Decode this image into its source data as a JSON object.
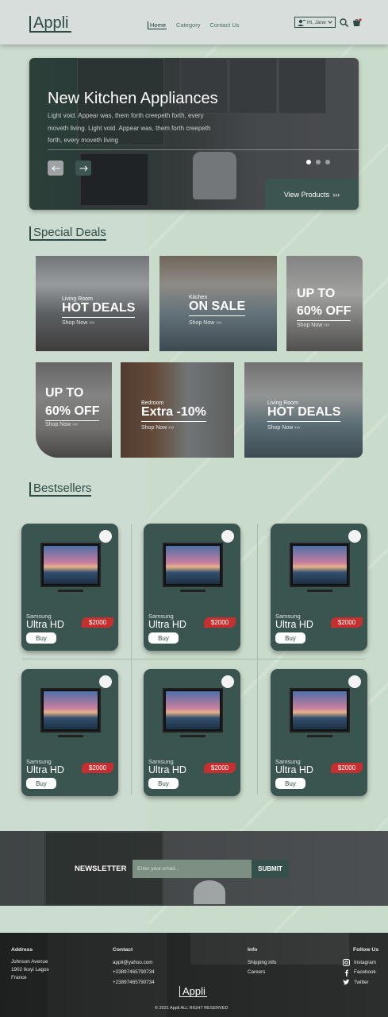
{
  "header": {
    "logo": "Appli",
    "nav": [
      "Home",
      "Category",
      "Contact Us"
    ],
    "user_label": "Hi, Jane"
  },
  "hero": {
    "title": "New Kitchen Appliances",
    "description": "Light void. Appear was, them forth creepeth forth, every moveth living. Light void. Appear was, them forth creepeth forth, every moveth living",
    "prev_icon": "arrow-left-icon",
    "next_icon": "arrow-right-icon",
    "slides": 3,
    "active_slide": 1,
    "cta": "View Products",
    "cta_arrows": "›››"
  },
  "special_deals": {
    "title": "Special Deals",
    "deals": [
      {
        "category": "Living Room",
        "headline": "HOT DEALS",
        "link": "Shop Now"
      },
      {
        "category": "Kitchen",
        "headline": "ON  SALE",
        "link": "Shop Now"
      },
      {
        "category": "",
        "headline": "UP TO",
        "headline2": "60% OFF",
        "link": "Shop Now"
      },
      {
        "category": "",
        "headline": "UP TO",
        "headline2": "60% OFF",
        "link": "Shop Now"
      },
      {
        "category": "Bedroom",
        "headline": "Extra -10%",
        "link": "Shop Now"
      },
      {
        "category": "Living Room",
        "headline": "HOT DEALS",
        "link": "Shop Now"
      }
    ],
    "arrows": "›››"
  },
  "bestsellers": {
    "title": "Bestsellers",
    "products": [
      {
        "brand": "Samsung",
        "model": "Ultra HD",
        "price": "$2000",
        "buy": "Buy"
      },
      {
        "brand": "Samsung",
        "model": "Ultra HD",
        "price": "$2000",
        "buy": "Buy"
      },
      {
        "brand": "Samsung",
        "model": "Ultra HD",
        "price": "$2000",
        "buy": "Buy"
      },
      {
        "brand": "Samsung",
        "model": "Ultra HD",
        "price": "$2000",
        "buy": "Buy"
      },
      {
        "brand": "Samsung",
        "model": "Ultra HD",
        "price": "$2000",
        "buy": "Buy"
      },
      {
        "brand": "Samsung",
        "model": "Ultra HD",
        "price": "$2000",
        "buy": "Buy"
      }
    ]
  },
  "newsletter": {
    "label": "NEWSLETTER",
    "placeholder": "Enter your email...",
    "submit": "SUBMIT"
  },
  "footer": {
    "address": {
      "heading": "Address",
      "lines": [
        "Johnson Avenue",
        "1902 Ikoyi Lagos",
        "France"
      ]
    },
    "contact": {
      "heading": "Contact",
      "lines": [
        "appli@yahoo.com",
        "+2389746579073​4",
        "+238974657907​34"
      ]
    },
    "info": {
      "heading": "Info",
      "lines": [
        "Shipping info",
        "Careers"
      ]
    },
    "follow": {
      "heading": "Follow Us",
      "items": [
        "Instagram",
        "Facebook",
        "Twitter"
      ]
    },
    "logo": "Appli",
    "copyright": "2021 Appli ALL RIGHT RESERVED"
  },
  "colors": {
    "accent": "#2f4a45",
    "price_badge": "#c62f2f",
    "hero_button": "#3d5550"
  }
}
